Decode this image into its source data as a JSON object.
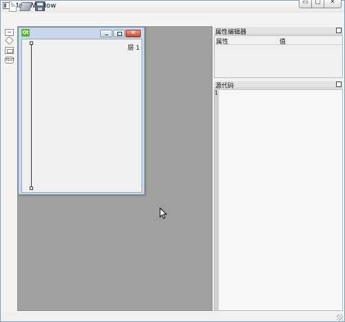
{
  "window": {
    "title": "MainWindow",
    "controls": {
      "minimize": "▭",
      "maximize": "▢",
      "close": "✕"
    }
  },
  "toolbar": {
    "icons": [
      "new-file-icon",
      "open-file-icon",
      "save-icon"
    ]
  },
  "widget_tools": {
    "icons": [
      "label-icon",
      "diamond-icon",
      "image-icon",
      "text-icon"
    ],
    "text_badge": "TEXT"
  },
  "subwindow": {
    "logo": "Qt",
    "controls": {
      "close": "✕"
    },
    "layer_label": "层 1"
  },
  "property_editor": {
    "title": "属性编辑器",
    "columns": [
      "属性",
      "值"
    ]
  },
  "source_code": {
    "title": "源代码",
    "line_numbers": [
      "1"
    ]
  },
  "colors": {
    "canvas": "#a0a09f",
    "subwindow_frame": "#c9d9eb",
    "close_button": "#c8452b",
    "qt_green": "#5bb334"
  }
}
